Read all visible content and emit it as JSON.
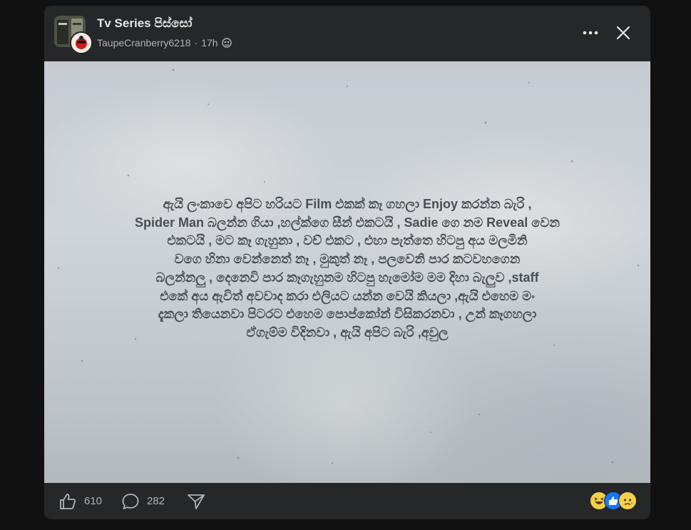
{
  "post": {
    "group_name": "Tv Series පිස්සෝ",
    "author": "TaupeCranberry6218",
    "separator": "·",
    "time": "17h",
    "privacy_icon": "globe-icon",
    "image_text": "ඇයි ලංකාවෙ අපිට හරියට Film එකක් කෑ ගහලා Enjoy කරන්න බැරි ,\nSpider Man බලන්න ගියා ,හල්ක්ගෙ සීන් එකටයි , Sadie ගෙ නම Reveal වෙන\nඑකටයි , මට කෑ ගැහුනා , වච් එකට , එහා පැත්තෙ හිටපු අය මලමිනි\nවගෙ හිනා වෙන්නෙත් නෑ , මුකුත් නෑ , පලවෙනි පාර කටවහගෙන\nබලන්නලු , දෙනෙවි පාර කෑගැහුනම හිටපු හැමෝම මම දිහා බැලුව ,staff\nඑකේ අය ඇවිත් අවවාද කරා එලියට යන්න වෙයි කියලා ,ඇයි එහෙම මං\nදැකලා තියෙනවා පිටරට එහෙම පොප්කෝන් විසිකරනවා , උන් කෑගහලා\nඒගැම්ම විදිනවා , ඇයි අපිට බැරි ,අවුල"
  },
  "actions": {
    "likes": "610",
    "comments": "282"
  },
  "icons": {
    "more": "more-horizontal-icon",
    "close": "close-icon",
    "like": "thumbs-up-icon",
    "comment": "comment-icon",
    "share": "share-icon"
  },
  "reactions": [
    "haha",
    "like",
    "sad"
  ],
  "colors": {
    "background": "#111112",
    "card": "#252728",
    "text_primary": "#e4e6eb",
    "text_secondary": "#b0b3b8",
    "like_blue": "#1877f2"
  }
}
